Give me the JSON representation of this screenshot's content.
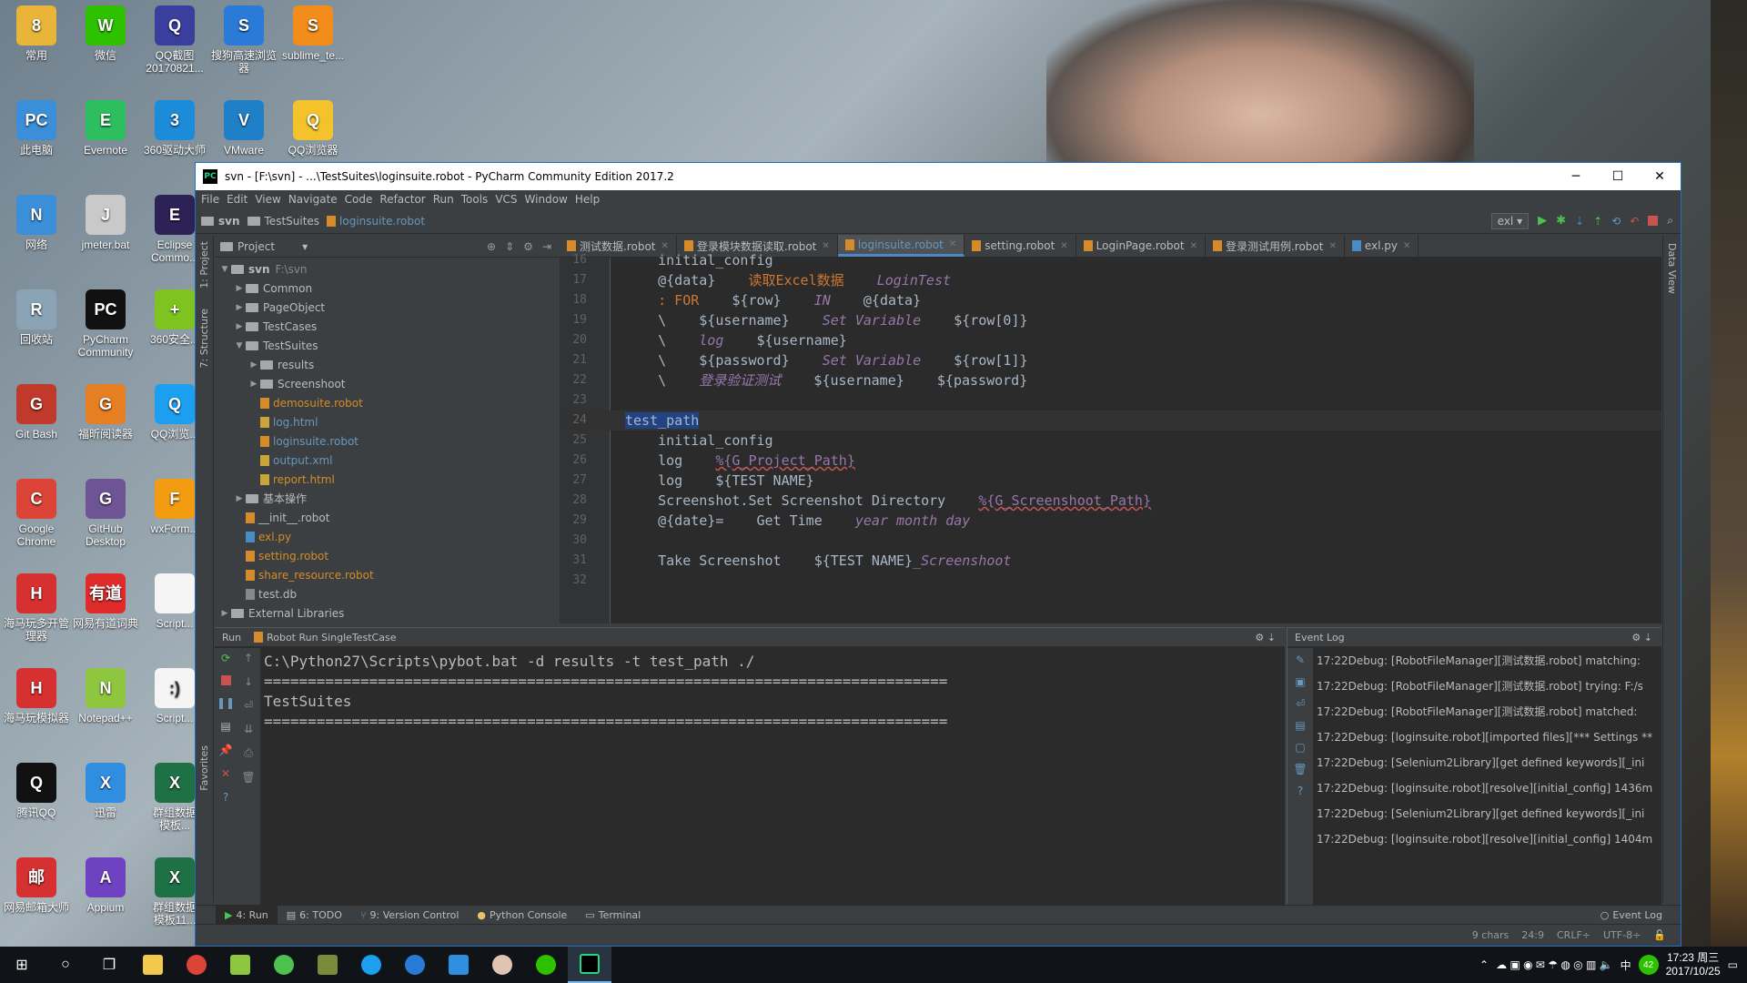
{
  "desktop": {
    "icons": [
      {
        "label": "常用",
        "color": "#e8b43a",
        "glyph": "8"
      },
      {
        "label": "微信",
        "color": "#2dc100",
        "glyph": "W"
      },
      {
        "label": "QQ截图\n20170821...",
        "color": "#3a3f9e",
        "glyph": "Q"
      },
      {
        "label": "搜狗高速浏览\n器",
        "color": "#2a7bd8",
        "glyph": "S"
      },
      {
        "label": "sublime_te...",
        "color": "#f28c1a",
        "glyph": "S"
      },
      {
        "label": "此电脑",
        "color": "#3b8fd9",
        "glyph": "PC"
      },
      {
        "label": "Evernote",
        "color": "#2dbe60",
        "glyph": "E"
      },
      {
        "label": "360驱动大师",
        "color": "#1c8bd9",
        "glyph": "3"
      },
      {
        "label": "VMware",
        "color": "#1f80c8",
        "glyph": "V"
      },
      {
        "label": "QQ浏览器",
        "color": "#f4c22b",
        "glyph": "Q"
      },
      {
        "label": "网络",
        "color": "#3b8fd9",
        "glyph": "N"
      },
      {
        "label": "jmeter.bat",
        "color": "#c9c9c9",
        "glyph": "J"
      },
      {
        "label": "Eclipse\nCommo...",
        "color": "#2c2255",
        "glyph": "E"
      },
      {
        "label": "回收站",
        "color": "#8aa3b5",
        "glyph": "R"
      },
      {
        "label": "PyCharm\nCommunity",
        "color": "#111111",
        "glyph": "PC"
      },
      {
        "label": "360安全...",
        "color": "#7fc320",
        "glyph": "+"
      },
      {
        "label": "Git Bash",
        "color": "#c0392b",
        "glyph": "G"
      },
      {
        "label": "福昕阅读器",
        "color": "#e67e22",
        "glyph": "G"
      },
      {
        "label": "QQ浏览...",
        "color": "#1d9ff0",
        "glyph": "Q"
      },
      {
        "label": "Google\nChrome",
        "color": "#db4437",
        "glyph": "C"
      },
      {
        "label": "GitHub\nDesktop",
        "color": "#6e5494",
        "glyph": "G"
      },
      {
        "label": "wxForm...",
        "color": "#f39c12",
        "glyph": "F"
      },
      {
        "label": "海马玩多开管\n理器",
        "color": "#d63031",
        "glyph": "H"
      },
      {
        "label": "网易有道词典",
        "color": "#e02b2b",
        "glyph": "有道"
      },
      {
        "label": "Script...",
        "color": "#f5f5f5",
        "glyph": ""
      },
      {
        "label": "海马玩模拟器",
        "color": "#d63031",
        "glyph": "H"
      },
      {
        "label": "Notepad++",
        "color": "#8ec63f",
        "glyph": "N"
      },
      {
        "label": "Script...",
        "color": "#f5f5f5",
        "glyph": ":)"
      },
      {
        "label": "腾讯QQ",
        "color": "#111111",
        "glyph": "Q"
      },
      {
        "label": "迅雷",
        "color": "#2f8ee0",
        "glyph": "X"
      },
      {
        "label": "群组数据\n模板...",
        "color": "#1e7145",
        "glyph": "X"
      },
      {
        "label": "网易邮箱大师",
        "color": "#d63031",
        "glyph": "邮"
      },
      {
        "label": "Appium",
        "color": "#6f42c1",
        "glyph": "A"
      },
      {
        "label": "群组数据\n模板11...",
        "color": "#1e7145",
        "glyph": "X"
      }
    ]
  },
  "window": {
    "title": "svn - [F:\\svn] - ...\\TestSuites\\loginsuite.robot - PyCharm Community Edition 2017.2",
    "controls": [
      "─",
      "☐",
      "✕"
    ]
  },
  "menu": [
    "File",
    "Edit",
    "View",
    "Navigate",
    "Code",
    "Refactor",
    "Run",
    "Tools",
    "VCS",
    "Window",
    "Help"
  ],
  "nav": {
    "crumbs": [
      "svn",
      "TestSuites",
      "loginsuite.robot"
    ],
    "run_config": "exl"
  },
  "project_panel": {
    "title": "Project",
    "tree": [
      {
        "label": "svn",
        "extra": "F:\\svn",
        "depth": 0,
        "arrow": "▼",
        "kind": "folder",
        "bold": true
      },
      {
        "label": "Common",
        "depth": 1,
        "arrow": "▶",
        "kind": "folder"
      },
      {
        "label": "PageObject",
        "depth": 1,
        "arrow": "▶",
        "kind": "folder"
      },
      {
        "label": "TestCases",
        "depth": 1,
        "arrow": "▶",
        "kind": "folder"
      },
      {
        "label": "TestSuites",
        "depth": 1,
        "arrow": "▼",
        "kind": "folder"
      },
      {
        "label": "results",
        "depth": 2,
        "arrow": "▶",
        "kind": "folder"
      },
      {
        "label": "Screenshoot",
        "depth": 2,
        "arrow": "▶",
        "kind": "folder"
      },
      {
        "label": "demosuite.robot",
        "depth": 2,
        "arrow": "",
        "kind": "robot",
        "color": "orange"
      },
      {
        "label": "log.html",
        "depth": 2,
        "arrow": "",
        "kind": "xml",
        "color": "blue"
      },
      {
        "label": "loginsuite.robot",
        "depth": 2,
        "arrow": "",
        "kind": "robot",
        "color": "blue"
      },
      {
        "label": "output.xml",
        "depth": 2,
        "arrow": "",
        "kind": "xml",
        "color": "blue"
      },
      {
        "label": "report.html",
        "depth": 2,
        "arrow": "",
        "kind": "xml",
        "color": "orange"
      },
      {
        "label": "基本操作",
        "depth": 1,
        "arrow": "▶",
        "kind": "folder"
      },
      {
        "label": "__init__.robot",
        "depth": 1,
        "arrow": "",
        "kind": "robot"
      },
      {
        "label": "exl.py",
        "depth": 1,
        "arrow": "",
        "kind": "py",
        "color": "orange"
      },
      {
        "label": "setting.robot",
        "depth": 1,
        "arrow": "",
        "kind": "robot",
        "color": "orange"
      },
      {
        "label": "share_resource.robot",
        "depth": 1,
        "arrow": "",
        "kind": "robot",
        "color": "orange"
      },
      {
        "label": "test.db",
        "depth": 1,
        "arrow": "",
        "kind": "db"
      },
      {
        "label": "External Libraries",
        "depth": 0,
        "arrow": "▶",
        "kind": "lib"
      }
    ]
  },
  "editor": {
    "tabs": [
      {
        "label": "测试数据.robot",
        "active": false
      },
      {
        "label": "登录模块数据读取.robot",
        "active": false
      },
      {
        "label": "loginsuite.robot",
        "active": true
      },
      {
        "label": "setting.robot",
        "active": false
      },
      {
        "label": "LoginPage.robot",
        "active": false
      },
      {
        "label": "登录测试用例.robot",
        "active": false
      },
      {
        "label": "exl.py",
        "active": false
      }
    ],
    "lines": [
      {
        "n": "16",
        "html": "    initial_config"
      },
      {
        "n": "17",
        "html": "    @{data}    <span class='kw'>读取Excel数据</span>    <span class='it'>LoginTest</span>"
      },
      {
        "n": "18",
        "html": "    <span class='kw'>: FOR</span>    ${row}    <span class='it'>IN</span>    @{data}"
      },
      {
        "n": "19",
        "html": "    \\    ${username}    <span class='it'>Set Variable</span>    ${row[0]}"
      },
      {
        "n": "20",
        "html": "    \\    <span class='it'>log</span>    ${username}"
      },
      {
        "n": "21",
        "html": "    \\    ${password}    <span class='it'>Set Variable</span>    ${row[1]}"
      },
      {
        "n": "22",
        "html": "    \\    <span class='it'>登录验证测试</span>    ${username}    ${password}"
      },
      {
        "n": "23",
        "html": ""
      },
      {
        "n": "24",
        "html": "<span class='tc'>test_path</span>"
      },
      {
        "n": "25",
        "html": "    initial_config"
      },
      {
        "n": "26",
        "html": "    log    <span class='und'>%{G_Project_Path}</span>"
      },
      {
        "n": "27",
        "html": "    log    ${TEST NAME}"
      },
      {
        "n": "28",
        "html": "    Screenshot.Set Screenshot Directory    <span class='und'>%{G_Screenshoot_Path}</span>"
      },
      {
        "n": "29",
        "html": "    @{date}=    Get Time    <span class='it'>year month day</span>"
      },
      {
        "n": "30",
        "html": ""
      },
      {
        "n": "31",
        "html": "    Take Screenshot    ${TEST NAME}<span class='it'>_Screenshoot</span>"
      },
      {
        "n": "32",
        "html": ""
      }
    ]
  },
  "run": {
    "label": "Run",
    "config": "Robot Run SingleTestCase",
    "console": "C:\\Python27\\Scripts\\pybot.bat -d results -t test_path ./\n==============================================================================\nTestSuites\n=============================================================================="
  },
  "event_log": {
    "title": "Event Log",
    "rows": [
      "17:22Debug: [RobotFileManager][测试数据.robot] matching:",
      "17:22Debug: [RobotFileManager][测试数据.robot] trying: F:/s",
      "17:22Debug: [RobotFileManager][测试数据.robot] matched:",
      "17:22Debug: [loginsuite.robot][imported files][*** Settings **",
      "17:22Debug: [Selenium2Library][get defined keywords][_ini",
      "17:22Debug: [loginsuite.robot][resolve][initial_config] 1436m",
      "17:22Debug: [Selenium2Library][get defined keywords][_ini",
      "17:22Debug: [loginsuite.robot][resolve][initial_config] 1404m"
    ]
  },
  "bottom_tabs": [
    {
      "label": "4: Run",
      "active": true
    },
    {
      "label": "6: TODO",
      "active": false
    },
    {
      "label": "9: Version Control",
      "active": false
    },
    {
      "label": "Python Console",
      "active": false
    },
    {
      "label": "Terminal",
      "active": false
    }
  ],
  "event_log_tab": "Event Log",
  "status": {
    "chars": "9 chars",
    "position": "24:9",
    "line_sep": "CRLF÷",
    "encoding": "UTF-8÷"
  },
  "side_tabs": {
    "project": "1: Project",
    "structure": "7: Structure",
    "favorites": "Favorites",
    "data_view": "Data View"
  },
  "taskbar": {
    "time": "17:23 周三",
    "date": "2017/10/25",
    "ime": "中",
    "badge": "42"
  }
}
